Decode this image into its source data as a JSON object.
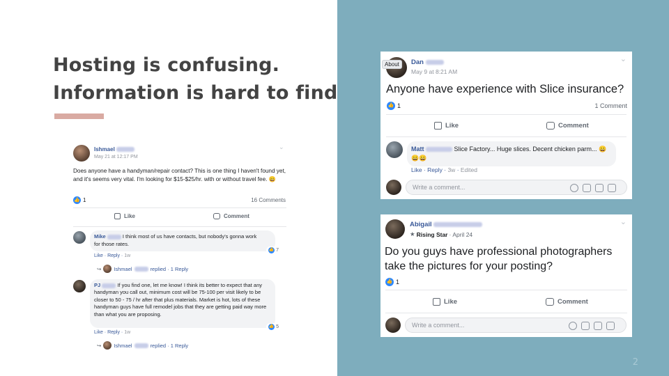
{
  "slide": {
    "headline_line1": "Hosting is confusing.",
    "headline_line2": "Information is hard to find.",
    "slide_number": "2",
    "accent_color": "#d9aaa2",
    "panel_color": "#7eadbd"
  },
  "post_left": {
    "author_first": "Ishmael",
    "timestamp": "May 21 at 12:17 PM",
    "body": "Does anyone have a handyman/repair contact? This is one thing I haven't found yet, and it's seems very vital. I'm looking for $15-$25/hr. with or without travel fee. 😀",
    "reaction_count": "1",
    "comments_count": "16 Comments",
    "like_label": "Like",
    "comment_label": "Comment",
    "comments": [
      {
        "author_first": "Mike",
        "text": "I think most of us have contacts, but nobody's gonna work for those rates.",
        "like_link": "Like",
        "reply_link": "Reply",
        "age": "1w",
        "reaction_count": "7",
        "reply_author": "Ishmael",
        "reply_text": "replied · 1 Reply"
      },
      {
        "author_first": "PJ",
        "text": "If you find one, let me know! I think its better to expect that any handyman you call out, minimum cost will be 75-100 per visit likely to be closer to 50 - 75 / hr after that plus materials. Market is hot, lots of these handyman guys have full remodel jobs that they are getting paid way more than what you are proposing.",
        "like_link": "Like",
        "reply_link": "Reply",
        "age": "1w",
        "reaction_count": "5",
        "reply_author": "Ishmael",
        "reply_text": "replied · 1 Reply"
      }
    ]
  },
  "post_dan": {
    "about_tag": "About",
    "author_first": "Dan",
    "timestamp": "May 9 at 8:21 AM",
    "body": "Anyone have experience with Slice insurance?",
    "reaction_count": "1",
    "comments_count": "1 Comment",
    "like_label": "Like",
    "comment_label": "Comment",
    "comment": {
      "author_first": "Matt",
      "text": "Slice Factory... Huge slices. Decent chicken parm... 😀😀😀",
      "like_link": "Like",
      "reply_link": "Reply",
      "age": "3w",
      "edited": "Edited"
    },
    "input_placeholder": "Write a comment..."
  },
  "post_abi": {
    "author_first": "Abigail",
    "badge": "Rising Star",
    "date": "April 24",
    "body": "Do you guys have professional photographers take the pictures for your posting?",
    "reaction_count": "1",
    "like_label": "Like",
    "comment_label": "Comment",
    "input_placeholder": "Write a comment..."
  },
  "icons": [
    "like-thumb-icon",
    "comment-bubble-icon",
    "chevron-down-icon",
    "emoji-icon",
    "camera-icon",
    "gif-icon",
    "sticker-icon",
    "reply-arrow-icon",
    "star-icon"
  ]
}
